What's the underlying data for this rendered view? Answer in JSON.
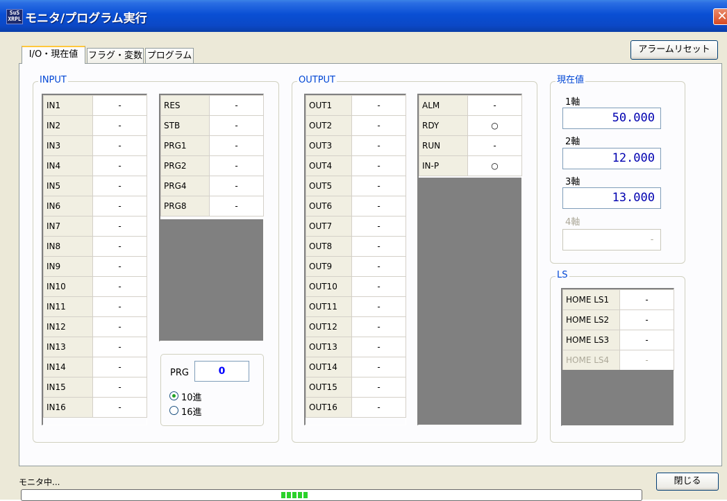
{
  "window": {
    "icon_text": "SuS XRPL",
    "title": "モニタ/プログラム実行",
    "close_glyph": "✕"
  },
  "tabs": [
    "I/O・現在値",
    "フラグ・変数",
    "プログラム"
  ],
  "alarm_reset_label": "アラームリセット",
  "input": {
    "group_label": "INPUT",
    "col1": [
      {
        "name": "IN1",
        "value": "-"
      },
      {
        "name": "IN2",
        "value": "-"
      },
      {
        "name": "IN3",
        "value": "-"
      },
      {
        "name": "IN4",
        "value": "-"
      },
      {
        "name": "IN5",
        "value": "-"
      },
      {
        "name": "IN6",
        "value": "-"
      },
      {
        "name": "IN7",
        "value": "-"
      },
      {
        "name": "IN8",
        "value": "-"
      },
      {
        "name": "IN9",
        "value": "-"
      },
      {
        "name": "IN10",
        "value": "-"
      },
      {
        "name": "IN11",
        "value": "-"
      },
      {
        "name": "IN12",
        "value": "-"
      },
      {
        "name": "IN13",
        "value": "-"
      },
      {
        "name": "IN14",
        "value": "-"
      },
      {
        "name": "IN15",
        "value": "-"
      },
      {
        "name": "IN16",
        "value": "-"
      }
    ],
    "col2": [
      {
        "name": "RES",
        "value": "-"
      },
      {
        "name": "STB",
        "value": "-"
      },
      {
        "name": "PRG1",
        "value": "-"
      },
      {
        "name": "PRG2",
        "value": "-"
      },
      {
        "name": "PRG4",
        "value": "-"
      },
      {
        "name": "PRG8",
        "value": "-"
      }
    ],
    "prg": {
      "label": "PRG",
      "value": "0",
      "radio_dec": "10進",
      "radio_hex": "16進",
      "selected": "10進"
    }
  },
  "output": {
    "group_label": "OUTPUT",
    "col1": [
      {
        "name": "OUT1",
        "value": "-"
      },
      {
        "name": "OUT2",
        "value": "-"
      },
      {
        "name": "OUT3",
        "value": "-"
      },
      {
        "name": "OUT4",
        "value": "-"
      },
      {
        "name": "OUT5",
        "value": "-"
      },
      {
        "name": "OUT6",
        "value": "-"
      },
      {
        "name": "OUT7",
        "value": "-"
      },
      {
        "name": "OUT8",
        "value": "-"
      },
      {
        "name": "OUT9",
        "value": "-"
      },
      {
        "name": "OUT10",
        "value": "-"
      },
      {
        "name": "OUT11",
        "value": "-"
      },
      {
        "name": "OUT12",
        "value": "-"
      },
      {
        "name": "OUT13",
        "value": "-"
      },
      {
        "name": "OUT14",
        "value": "-"
      },
      {
        "name": "OUT15",
        "value": "-"
      },
      {
        "name": "OUT16",
        "value": "-"
      }
    ],
    "col2": [
      {
        "name": "ALM",
        "value": "-"
      },
      {
        "name": "RDY",
        "value": "○"
      },
      {
        "name": "RUN",
        "value": "-"
      },
      {
        "name": "IN-P",
        "value": "○"
      }
    ]
  },
  "current": {
    "group_label": "現在値",
    "axes": [
      {
        "label": "1軸",
        "value": "50.000"
      },
      {
        "label": "2軸",
        "value": "12.000"
      },
      {
        "label": "3軸",
        "value": "13.000"
      },
      {
        "label": "4軸",
        "value": "-"
      }
    ]
  },
  "ls": {
    "group_label": "LS",
    "rows": [
      {
        "name": "HOME LS1",
        "value": "-"
      },
      {
        "name": "HOME LS2",
        "value": "-"
      },
      {
        "name": "HOME LS3",
        "value": "-"
      },
      {
        "name": "HOME LS4",
        "value": "-"
      }
    ]
  },
  "status": {
    "text": "モニタ中...",
    "progress_blocks": 5
  },
  "close_label": "閉じる"
}
